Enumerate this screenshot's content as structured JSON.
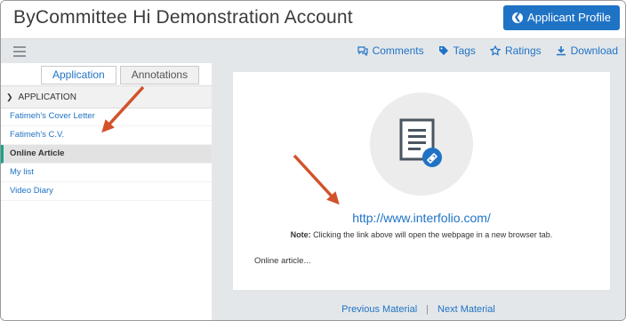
{
  "header": {
    "title": "ByCommittee Hi Demonstration Account",
    "profile_button": "Applicant Profile"
  },
  "toolbar": {
    "comments": "Comments",
    "tags": "Tags",
    "ratings": "Ratings",
    "download": "Download"
  },
  "sidebar": {
    "tabs": {
      "application": "Application",
      "annotations": "Annotations"
    },
    "section_title": "APPLICATION",
    "items": [
      {
        "label": "Fatimeh's Cover Letter"
      },
      {
        "label": "Fatimeh's C.V."
      },
      {
        "label": "Online Article",
        "active": true
      },
      {
        "label": "My list"
      },
      {
        "label": "Video Diary"
      }
    ]
  },
  "main": {
    "link_url": "http://www.interfolio.com/",
    "note_label": "Note:",
    "note_text": " Clicking the link above will open the webpage in a new browser tab.",
    "description": "Online article...",
    "pager": {
      "previous": "Previous Material",
      "separator": "|",
      "next": "Next Material"
    }
  },
  "colors": {
    "accent": "#1f73c5",
    "active_marker": "#1aa387",
    "arrow": "#d2522a"
  }
}
